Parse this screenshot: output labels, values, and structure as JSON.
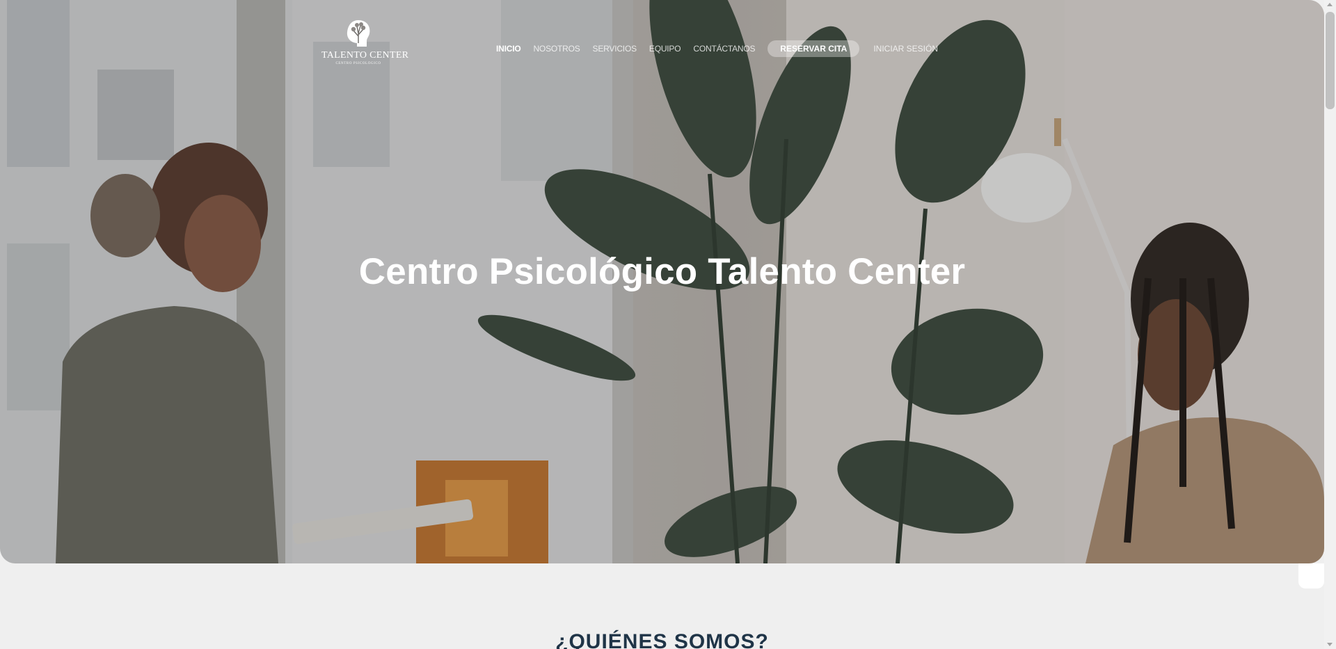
{
  "logo": {
    "name": "TALENTO CENTER",
    "subtitle": "CENTRO PSICOLÓGICO"
  },
  "nav": {
    "items": [
      {
        "label": "INICIO",
        "active": true
      },
      {
        "label": "NOSOTROS",
        "active": false
      },
      {
        "label": "SERVICIOS",
        "active": false
      },
      {
        "label": "EQUIPO",
        "active": false
      },
      {
        "label": "CONTÁCTANOS",
        "active": false
      }
    ],
    "reserve_label": "RESERVAR CITA",
    "login_label": "INICIAR SESIÓN"
  },
  "hero": {
    "title": "Centro Psicológico Talento Center"
  },
  "about": {
    "title": "¿QUIÉNES SOMOS?"
  },
  "colors": {
    "accent_dark": "#1f3447",
    "hero_overlay": "#282828",
    "background": "#efefef"
  }
}
